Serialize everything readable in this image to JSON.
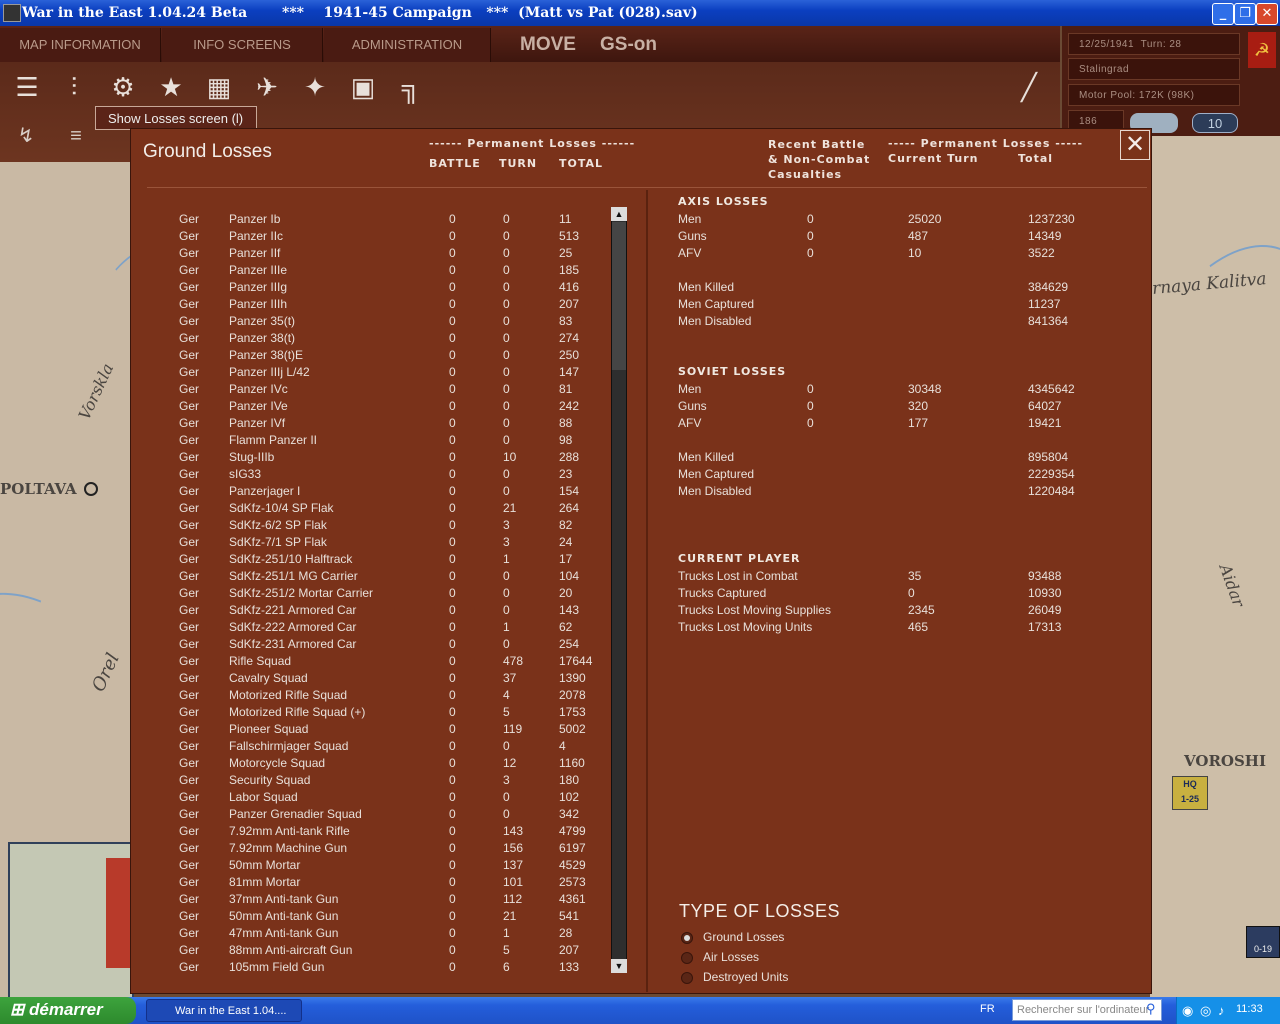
{
  "window": {
    "title": "War in the East 1.04.24 Beta",
    "subtitle": "***    1941-45 Campaign   ***  (Matt vs Pat (028).sav)"
  },
  "menu": {
    "tabs": [
      "MAP INFORMATION",
      "INFO SCREENS",
      "ADMINISTRATION"
    ],
    "mode": "MOVE",
    "gs": "GS-on"
  },
  "tooltip": "Show Losses screen (l)",
  "info": {
    "date": "12/25/1941",
    "turn": "Turn: 28",
    "location": "Stalingrad",
    "motor_pool": "Motor Pool:  172K (98K)",
    "value": "186",
    "pill": "10"
  },
  "map": {
    "labels": [
      "POLTAVA",
      "Vorskla",
      "Orel",
      "rnaya Kalitva",
      "Aidar",
      "VOROSHI"
    ],
    "hq_label": "HQ",
    "hq_unit": "1-25",
    "unit2": "0-19"
  },
  "losses": {
    "title": "Ground Losses",
    "perm_header": "------ Permanent Losses ------",
    "col_battle": "BATTLE",
    "col_turn": "TURN",
    "col_total": "TOTAL",
    "recent_header": "Recent Battle\n& Non-Combat\nCasualties",
    "perm_header2": "----- Permanent Losses -----",
    "col_current": "Current Turn",
    "col_total2": "Total",
    "rows": [
      [
        "Ger",
        "Panzer Ib",
        "0",
        "0",
        "11"
      ],
      [
        "Ger",
        "Panzer IIc",
        "0",
        "0",
        "513"
      ],
      [
        "Ger",
        "Panzer IIf",
        "0",
        "0",
        "25"
      ],
      [
        "Ger",
        "Panzer IIIe",
        "0",
        "0",
        "185"
      ],
      [
        "Ger",
        "Panzer IIIg",
        "0",
        "0",
        "416"
      ],
      [
        "Ger",
        "Panzer IIIh",
        "0",
        "0",
        "207"
      ],
      [
        "Ger",
        "Panzer 35(t)",
        "0",
        "0",
        "83"
      ],
      [
        "Ger",
        "Panzer 38(t)",
        "0",
        "0",
        "274"
      ],
      [
        "Ger",
        "Panzer 38(t)E",
        "0",
        "0",
        "250"
      ],
      [
        "Ger",
        "Panzer IIIj L/42",
        "0",
        "0",
        "147"
      ],
      [
        "Ger",
        "Panzer IVc",
        "0",
        "0",
        "81"
      ],
      [
        "Ger",
        "Panzer IVe",
        "0",
        "0",
        "242"
      ],
      [
        "Ger",
        "Panzer IVf",
        "0",
        "0",
        "88"
      ],
      [
        "Ger",
        "Flamm Panzer II",
        "0",
        "0",
        "98"
      ],
      [
        "Ger",
        "Stug-IIIb",
        "0",
        "10",
        "288"
      ],
      [
        "Ger",
        "sIG33",
        "0",
        "0",
        "23"
      ],
      [
        "Ger",
        "Panzerjager I",
        "0",
        "0",
        "154"
      ],
      [
        "Ger",
        "SdKfz-10/4 SP Flak",
        "0",
        "21",
        "264"
      ],
      [
        "Ger",
        "SdKfz-6/2 SP Flak",
        "0",
        "3",
        "82"
      ],
      [
        "Ger",
        "SdKfz-7/1 SP Flak",
        "0",
        "3",
        "24"
      ],
      [
        "Ger",
        "SdKfz-251/10 Halftrack",
        "0",
        "1",
        "17"
      ],
      [
        "Ger",
        "SdKfz-251/1 MG Carrier",
        "0",
        "0",
        "104"
      ],
      [
        "Ger",
        "SdKfz-251/2 Mortar Carrier",
        "0",
        "0",
        "20"
      ],
      [
        "Ger",
        "SdKfz-221 Armored Car",
        "0",
        "0",
        "143"
      ],
      [
        "Ger",
        "SdKfz-222 Armored Car",
        "0",
        "1",
        "62"
      ],
      [
        "Ger",
        "SdKfz-231 Armored Car",
        "0",
        "0",
        "254"
      ],
      [
        "Ger",
        "Rifle Squad",
        "0",
        "478",
        "17644"
      ],
      [
        "Ger",
        "Cavalry Squad",
        "0",
        "37",
        "1390"
      ],
      [
        "Ger",
        "Motorized Rifle Squad",
        "0",
        "4",
        "2078"
      ],
      [
        "Ger",
        "Motorized Rifle Squad (+)",
        "0",
        "5",
        "1753"
      ],
      [
        "Ger",
        "Pioneer Squad",
        "0",
        "119",
        "5002"
      ],
      [
        "Ger",
        "Fallschirmjager Squad",
        "0",
        "0",
        "4"
      ],
      [
        "Ger",
        "Motorcycle Squad",
        "0",
        "12",
        "1160"
      ],
      [
        "Ger",
        "Security Squad",
        "0",
        "3",
        "180"
      ],
      [
        "Ger",
        "Labor Squad",
        "0",
        "0",
        "102"
      ],
      [
        "Ger",
        "Panzer Grenadier Squad",
        "0",
        "0",
        "342"
      ],
      [
        "Ger",
        "7.92mm Anti-tank Rifle",
        "0",
        "143",
        "4799"
      ],
      [
        "Ger",
        "7.92mm Machine Gun",
        "0",
        "156",
        "6197"
      ],
      [
        "Ger",
        "50mm Mortar",
        "0",
        "137",
        "4529"
      ],
      [
        "Ger",
        "81mm Mortar",
        "0",
        "101",
        "2573"
      ],
      [
        "Ger",
        "37mm Anti-tank Gun",
        "0",
        "112",
        "4361"
      ],
      [
        "Ger",
        "50mm Anti-tank Gun",
        "0",
        "21",
        "541"
      ],
      [
        "Ger",
        "47mm Anti-tank Gun",
        "0",
        "1",
        "28"
      ],
      [
        "Ger",
        "88mm Anti-aircraft Gun",
        "0",
        "5",
        "207"
      ],
      [
        "Ger",
        "105mm Field Gun",
        "0",
        "6",
        "133"
      ]
    ],
    "axis": {
      "title": "AXIS LOSSES",
      "rows": [
        [
          "Men",
          "0",
          "25020",
          "1237230"
        ],
        [
          "Guns",
          "0",
          "487",
          "14349"
        ],
        [
          "AFV",
          "0",
          "10",
          "3522"
        ]
      ],
      "men_rows": [
        [
          "Men Killed",
          "384629"
        ],
        [
          "Men Captured",
          "11237"
        ],
        [
          "Men Disabled",
          "841364"
        ]
      ]
    },
    "soviet": {
      "title": "SOVIET LOSSES",
      "rows": [
        [
          "Men",
          "0",
          "30348",
          "4345642"
        ],
        [
          "Guns",
          "0",
          "320",
          "64027"
        ],
        [
          "AFV",
          "0",
          "177",
          "19421"
        ]
      ],
      "men_rows": [
        [
          "Men Killed",
          "895804"
        ],
        [
          "Men Captured",
          "2229354"
        ],
        [
          "Men Disabled",
          "1220484"
        ]
      ]
    },
    "player": {
      "title": "CURRENT PLAYER",
      "rows": [
        [
          "Trucks Lost in Combat",
          "35",
          "93488"
        ],
        [
          "Trucks Captured",
          "0",
          "10930"
        ],
        [
          "Trucks Lost Moving Supplies",
          "2345",
          "26049"
        ],
        [
          "Trucks Lost Moving Units",
          "465",
          "17313"
        ]
      ]
    },
    "type": {
      "title": "TYPE OF LOSSES",
      "options": [
        "Ground Losses",
        "Air Losses",
        "Destroyed Units"
      ],
      "selected": 0
    }
  },
  "taskbar": {
    "start": "démarrer",
    "item": "War in the East 1.04....",
    "lang": "FR",
    "search": "Rechercher sur l'ordinateur",
    "clock": "11:33"
  }
}
